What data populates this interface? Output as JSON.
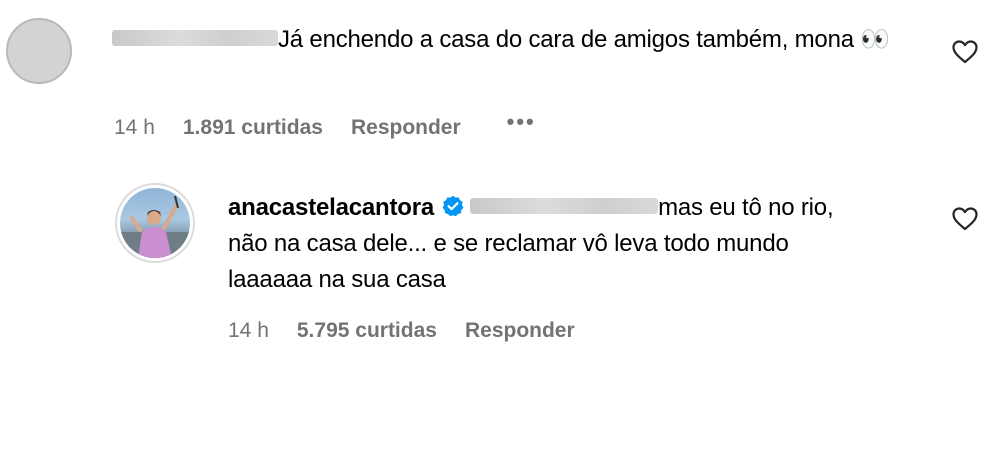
{
  "comments": [
    {
      "text": "Já enchendo a casa do cara de amigos também, mona 👀",
      "time": "14 h",
      "likes": "1.891 curtidas",
      "reply_label": "Responder",
      "more_label": "•••"
    }
  ],
  "reply": {
    "username": "anacastelacantora",
    "text_line1": "mas eu tô no rio,",
    "text_line2": "não na casa dele... e se reclamar vô leva todo mundo",
    "text_line3": "laaaaaa na sua casa",
    "time": "14 h",
    "likes": "5.795 curtidas",
    "reply_label": "Responder"
  },
  "icons": {
    "like": "heart-outline-icon",
    "verified": "verified-badge-icon",
    "more": "more-options-icon"
  },
  "colors": {
    "meta_text": "#737373",
    "verified_badge": "#0095f6"
  }
}
